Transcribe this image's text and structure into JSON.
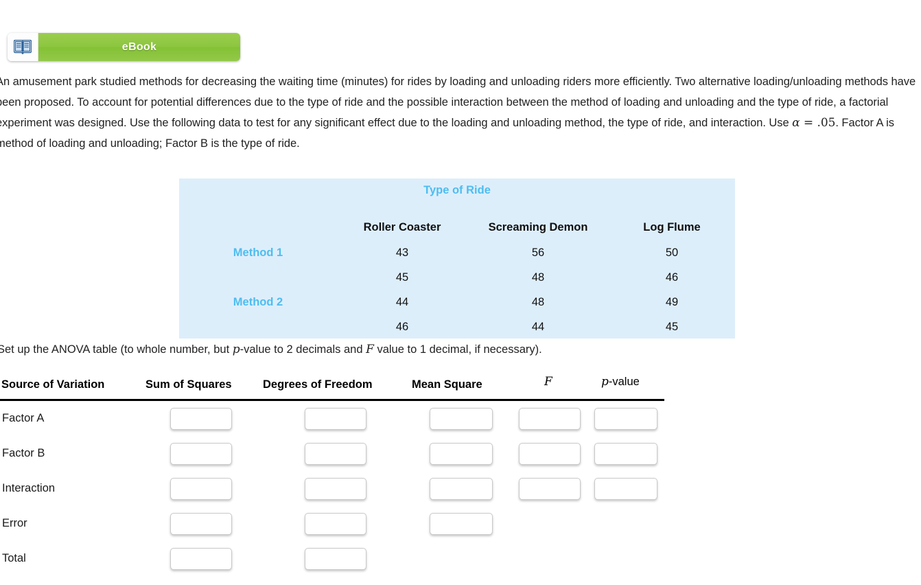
{
  "ebook": {
    "icon": "open-book-icon",
    "label": "eBook"
  },
  "prompt": {
    "part1": "An amusement park studied methods for decreasing the waiting time (minutes) for rides by loading and unloading riders more efficiently. Two alternative loading/unloading methods have been proposed. To account for potential differences due to the type of ride and the possible interaction between the method of loading and unloading and the type of ride, a factorial experiment was designed. Use the following data to test for any significant effect due to the loading and unloading method, the type of ride, and interaction. Use ",
    "alpha": "α",
    "equals": " = ",
    "alpha_value": ".05",
    "part2": ". Factor A is method of loading and unloading; Factor B is the type of ride."
  },
  "data_table": {
    "title": "Type of Ride",
    "column_headers": [
      "Roller Coaster",
      "Screaming Demon",
      "Log Flume"
    ],
    "rows": [
      {
        "label": "Method 1",
        "values": [
          "43",
          "56",
          "50"
        ]
      },
      {
        "label": "",
        "values": [
          "45",
          "48",
          "46"
        ]
      },
      {
        "label": "Method 2",
        "values": [
          "44",
          "48",
          "49"
        ]
      },
      {
        "label": "",
        "values": [
          "46",
          "44",
          "45"
        ]
      }
    ],
    "background_color": "#ddeefb",
    "accent_color": "#4ebdef"
  },
  "instruction": {
    "part1": "Set up the ANOVA table (to whole number, but ",
    "p": "p",
    "part2": "-value to 2 decimals and ",
    "f": "F",
    "part3": " value to 1 decimal, if necessary)."
  },
  "anova": {
    "headers": {
      "source": "Source of Variation",
      "ss": "Sum of Squares",
      "df": "Degrees of Freedom",
      "ms": "Mean Square",
      "f": "F",
      "p_prefix": "p",
      "p_suffix": "-value"
    },
    "rows": [
      {
        "label": "Factor A",
        "ss": "",
        "df": "",
        "ms": "",
        "f": "",
        "p": ""
      },
      {
        "label": "Factor B",
        "ss": "",
        "df": "",
        "ms": "",
        "f": "",
        "p": ""
      },
      {
        "label": "Interaction",
        "ss": "",
        "df": "",
        "ms": "",
        "f": "",
        "p": ""
      },
      {
        "label": "Error",
        "ss": "",
        "df": "",
        "ms": ""
      },
      {
        "label": "Total",
        "ss": "",
        "df": ""
      }
    ]
  }
}
